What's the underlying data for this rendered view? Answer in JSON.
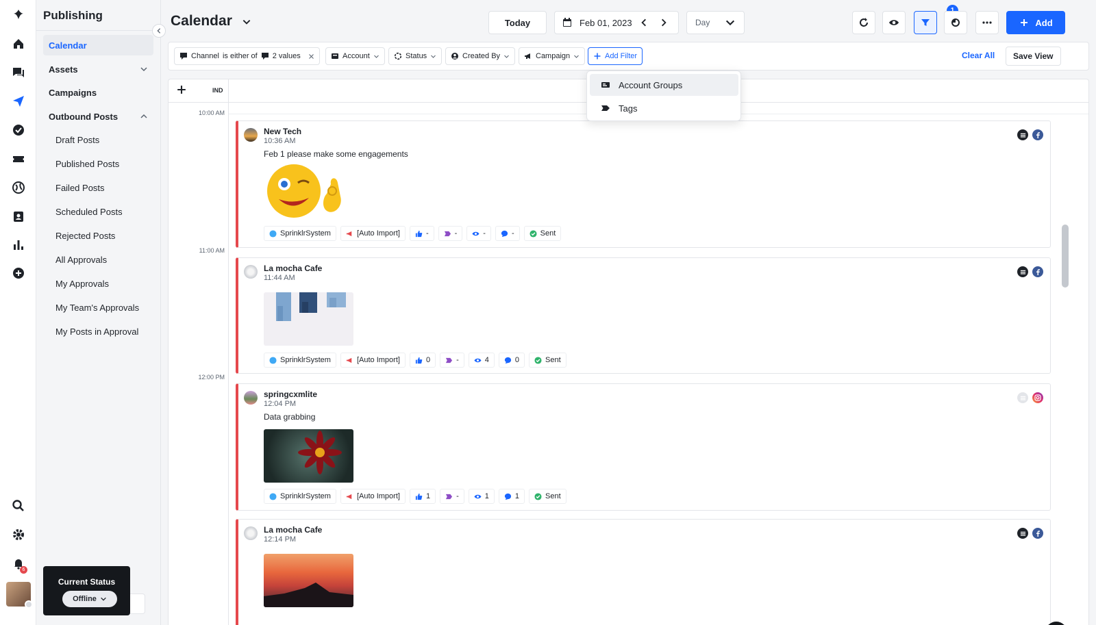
{
  "sidebar": {
    "title": "Publishing",
    "items": [
      {
        "label": "Calendar"
      },
      {
        "label": "Assets"
      },
      {
        "label": "Campaigns"
      },
      {
        "label": "Outbound Posts"
      }
    ],
    "outbound_sub": [
      {
        "label": "Draft Posts"
      },
      {
        "label": "Published Posts"
      },
      {
        "label": "Failed Posts"
      },
      {
        "label": "Scheduled Posts"
      },
      {
        "label": "Rejected Posts"
      },
      {
        "label": "All Approvals"
      },
      {
        "label": "My Approvals"
      },
      {
        "label": "My Team's Approvals"
      },
      {
        "label": "My Posts in Approval"
      }
    ],
    "status": {
      "label": "Current Status",
      "value": "Offline"
    },
    "notification_count": "6"
  },
  "header": {
    "title": "Calendar",
    "today": "Today",
    "date": "Feb 01, 2023",
    "view": "Day",
    "filter_count": "1",
    "add": "Add"
  },
  "filters": {
    "channel": {
      "field": "Channel",
      "op": "is either of",
      "value": "2 values"
    },
    "chips": [
      "Account",
      "Status",
      "Created By",
      "Campaign"
    ],
    "add_filter": "Add Filter",
    "clear_all": "Clear All",
    "save_view": "Save View"
  },
  "dropdown": {
    "items": [
      {
        "label": "Account Groups"
      },
      {
        "label": "Tags"
      }
    ]
  },
  "calendar": {
    "timezone": "IND",
    "times": [
      "10:00 AM",
      "11:00 AM",
      "12:00 PM"
    ],
    "posts": [
      {
        "account": "New Tech",
        "time": "10:36 AM",
        "text": "Feb 1 please make some engagements",
        "network": "facebook",
        "user": "SprinklrSystem",
        "campaign": "[Auto Import]",
        "likes": "-",
        "tags": "-",
        "views": "-",
        "comments": "-",
        "status": "Sent"
      },
      {
        "account": "La mocha Cafe",
        "time": "11:44 AM",
        "text": "",
        "network": "facebook",
        "user": "SprinklrSystem",
        "campaign": "[Auto Import]",
        "likes": "0",
        "tags": "-",
        "views": "4",
        "comments": "0",
        "status": "Sent"
      },
      {
        "account": "springcxmlite",
        "time": "12:04 PM",
        "text": "Data grabbing",
        "network": "instagram",
        "user": "SprinklrSystem",
        "campaign": "[Auto Import]",
        "likes": "1",
        "tags": "-",
        "views": "1",
        "comments": "1",
        "status": "Sent"
      },
      {
        "account": "La mocha Cafe",
        "time": "12:14 PM",
        "text": "",
        "network": "facebook"
      }
    ]
  },
  "colors": {
    "accent": "#1a66ff",
    "post_bar": "#e5484d",
    "facebook": "#3b5998",
    "success": "#2fb36b"
  }
}
